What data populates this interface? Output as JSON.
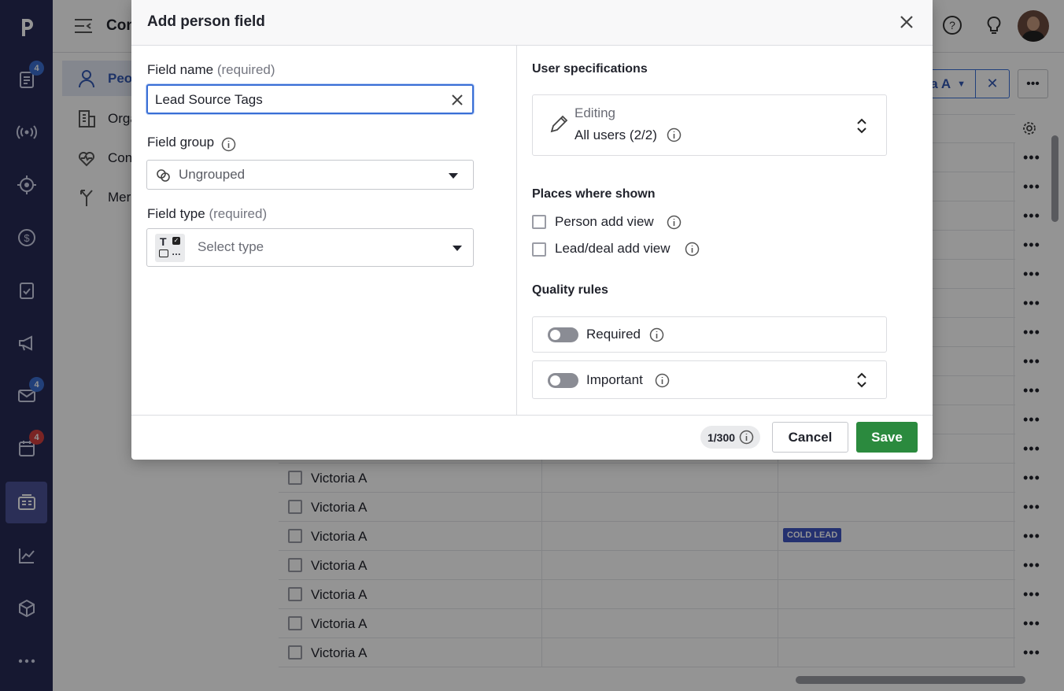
{
  "nav": {
    "badges": {
      "leads": "4",
      "mail": "4",
      "activities": "4"
    }
  },
  "subnav": {
    "items": [
      {
        "label": "Peo"
      },
      {
        "label": "Orga"
      },
      {
        "label": "Con"
      },
      {
        "label": "Merg"
      }
    ]
  },
  "topbar": {
    "title": "Con",
    "filter_label": "a A"
  },
  "grid": {
    "rows": [
      {
        "name": "Victoria A",
        "tag": ""
      },
      {
        "name": "Victoria A",
        "tag": ""
      },
      {
        "name": "Victoria A",
        "tag": "COLD LEAD"
      },
      {
        "name": "Victoria A",
        "tag": ""
      },
      {
        "name": "Victoria A",
        "tag": ""
      },
      {
        "name": "Victoria A",
        "tag": ""
      },
      {
        "name": "Victoria A",
        "tag": ""
      }
    ]
  },
  "modal": {
    "title": "Add person field",
    "field_name": {
      "label": "Field name",
      "hint": "(required)",
      "value": "Lead Source Tags"
    },
    "field_group": {
      "label": "Field group",
      "value": "Ungrouped"
    },
    "field_type": {
      "label": "Field type",
      "hint": "(required)",
      "placeholder": "Select type"
    },
    "user_specs": {
      "heading": "User specifications",
      "editing_label": "Editing",
      "editing_value": "All users (2/2)"
    },
    "places": {
      "heading": "Places where shown",
      "person_add_view": "Person add view",
      "lead_deal_add_view": "Lead/deal add view"
    },
    "quality": {
      "heading": "Quality rules",
      "required": "Required",
      "important": "Important"
    },
    "footer": {
      "counter": "1/300",
      "cancel": "Cancel",
      "save": "Save"
    }
  },
  "colors": {
    "nav_bg": "#262a55",
    "save_green": "#2b8a3e",
    "focus_blue": "#3a6fd6",
    "tag_blue": "#3f55c1"
  }
}
